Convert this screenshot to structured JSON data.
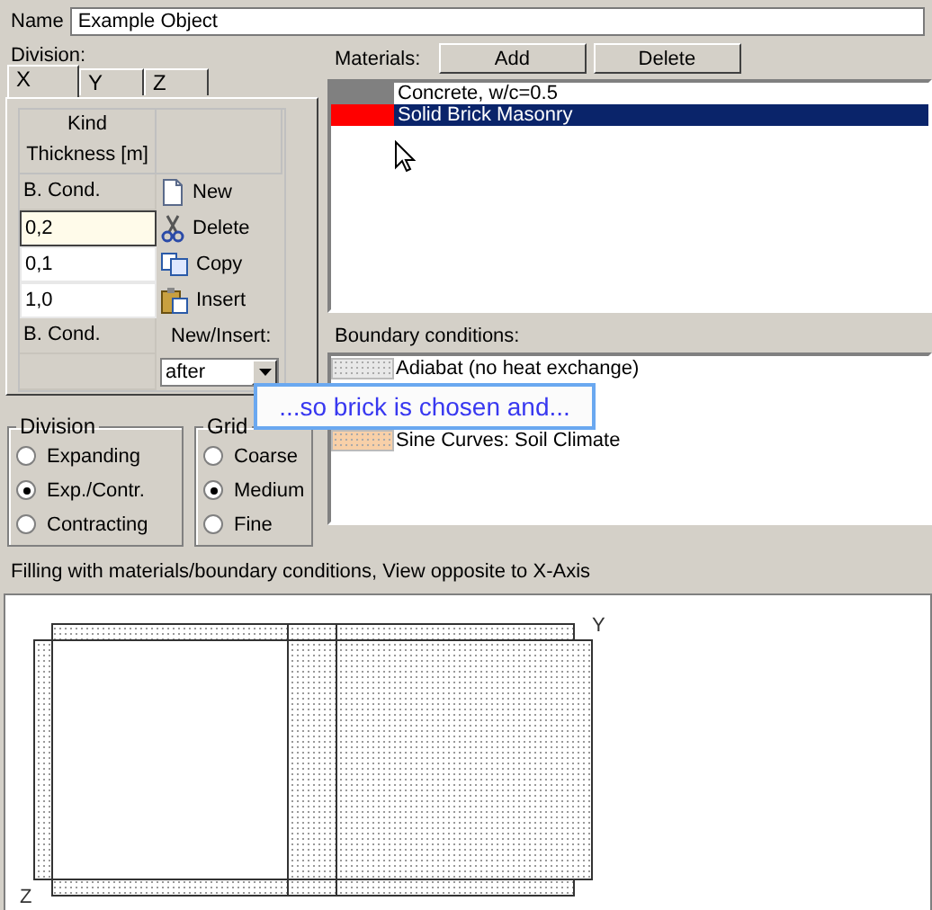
{
  "name_field": {
    "label": "Name",
    "value": "Example Object"
  },
  "division_label": "Division:",
  "tabs": [
    {
      "label": "X",
      "selected": true
    },
    {
      "label": "Y",
      "selected": false
    },
    {
      "label": "Z",
      "selected": false
    }
  ],
  "layer_table": {
    "header": [
      "Kind",
      "Thickness [m]"
    ],
    "rows": [
      {
        "kind": "label",
        "text": "B. Cond."
      },
      {
        "kind": "input",
        "text": "0,2",
        "focused": true
      },
      {
        "kind": "input",
        "text": "0,1",
        "focused": false
      },
      {
        "kind": "input",
        "text": "1,0",
        "focused": false
      },
      {
        "kind": "label",
        "text": "B. Cond."
      }
    ]
  },
  "layer_actions": [
    {
      "kind": "new",
      "label": "New"
    },
    {
      "kind": "delete",
      "label": "Delete"
    },
    {
      "kind": "copy",
      "label": "Copy"
    },
    {
      "kind": "insert",
      "label": "Insert"
    }
  ],
  "new_insert": {
    "label": "New/Insert:",
    "value": "after"
  },
  "division_group": {
    "title": "Division",
    "options": [
      {
        "label": "Expanding",
        "selected": false
      },
      {
        "label": "Exp./Contr.",
        "selected": true
      },
      {
        "label": "Contracting",
        "selected": false
      }
    ]
  },
  "grid_group": {
    "title": "Grid",
    "options": [
      {
        "label": "Coarse",
        "selected": false
      },
      {
        "label": "Medium",
        "selected": true
      },
      {
        "label": "Fine",
        "selected": false
      }
    ]
  },
  "materials": {
    "label": "Materials:",
    "buttons": [
      "Add",
      "Delete"
    ],
    "items": [
      {
        "name": "Concrete, w/c=0.5",
        "color": "#808080",
        "selected": false
      },
      {
        "name": "Solid Brick Masonry",
        "color": "#ff0000",
        "selected": true
      }
    ]
  },
  "boundary": {
    "label": "Boundary conditions:",
    "items": [
      {
        "name": "Adiabat (no heat exchange)",
        "color": "#e8e8e8"
      },
      {
        "name": "Sine Curves: Soil Climate",
        "color": "#f8d0a8"
      }
    ]
  },
  "tooltip": "...so brick is chosen and...",
  "view": {
    "label": "Filling with materials/boundary conditions, View opposite to X-Axis",
    "axis_y": "Y",
    "axis_z": "Z"
  }
}
